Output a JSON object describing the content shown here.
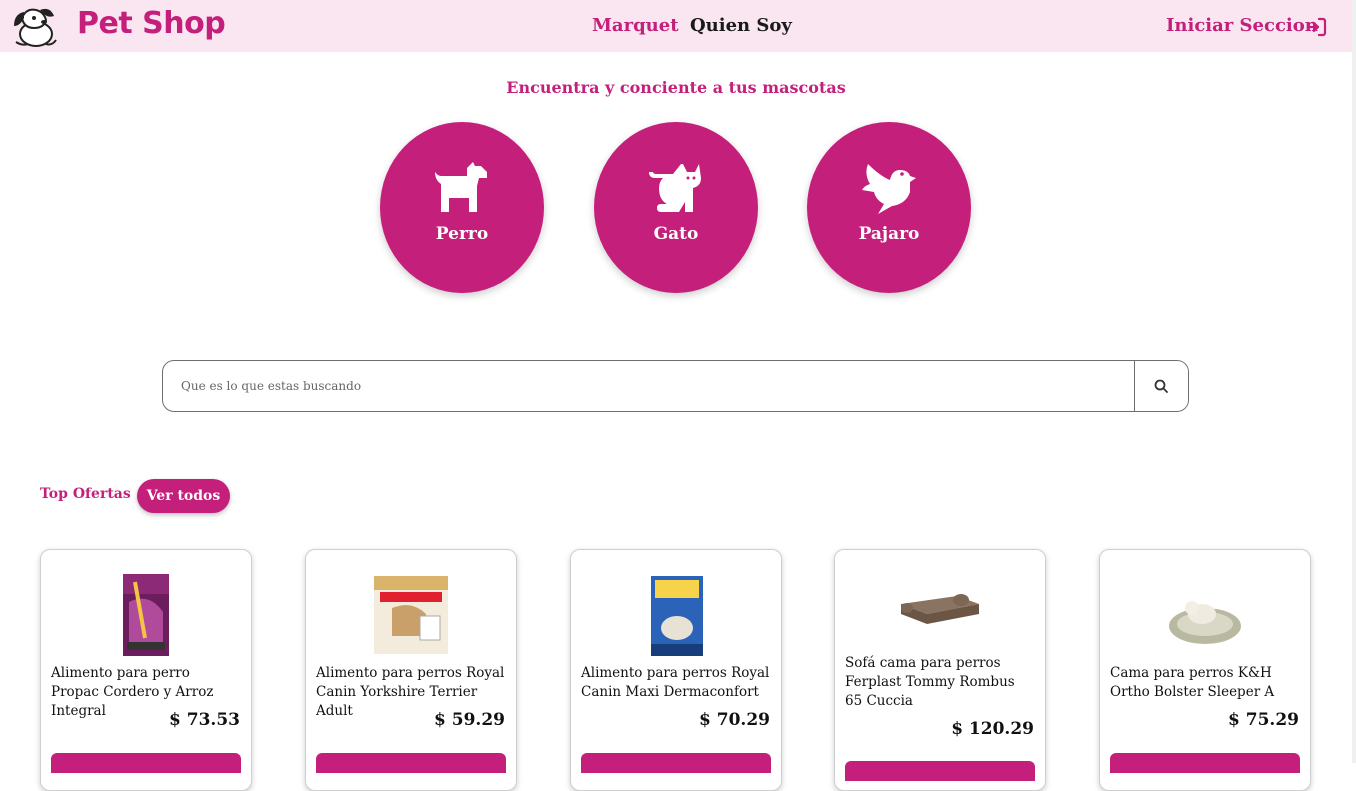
{
  "brand": {
    "name": "Pet Shop"
  },
  "nav": {
    "marquet": "Marquet",
    "quien_soy": "Quien Soy",
    "login": "Iniciar Seccion"
  },
  "hero": {
    "title": "Encuentra y conciente a tus mascotas"
  },
  "categories": [
    {
      "label": "Perro",
      "icon": "dog-icon"
    },
    {
      "label": "Gato",
      "icon": "cat-icon"
    },
    {
      "label": "Pajaro",
      "icon": "bird-icon"
    }
  ],
  "search": {
    "placeholder": "Que es lo que estas buscando",
    "icon": "search-icon"
  },
  "offers": {
    "title": "Top Ofertas",
    "view_all": "Ver todos"
  },
  "products": [
    {
      "name": "Alimento para perro Propac Cordero y Arroz Integral",
      "price": "$ 73.53"
    },
    {
      "name": "Alimento para perros Royal Canin Yorkshire Terrier Adult",
      "price": "$ 59.29"
    },
    {
      "name": "Alimento para perros Royal Canin Maxi Dermaconfort",
      "price": "$ 70.29"
    },
    {
      "name": "Sofá cama para perros Ferplast Tommy Rombus 65 Cuccia",
      "price": "$ 120.29"
    },
    {
      "name": "Cama para perros K&H Ortho Bolster Sleeper A",
      "price": "$ 75.29"
    }
  ],
  "colors": {
    "accent": "#c41f7a",
    "nav_bg": "#f9e6f0"
  }
}
